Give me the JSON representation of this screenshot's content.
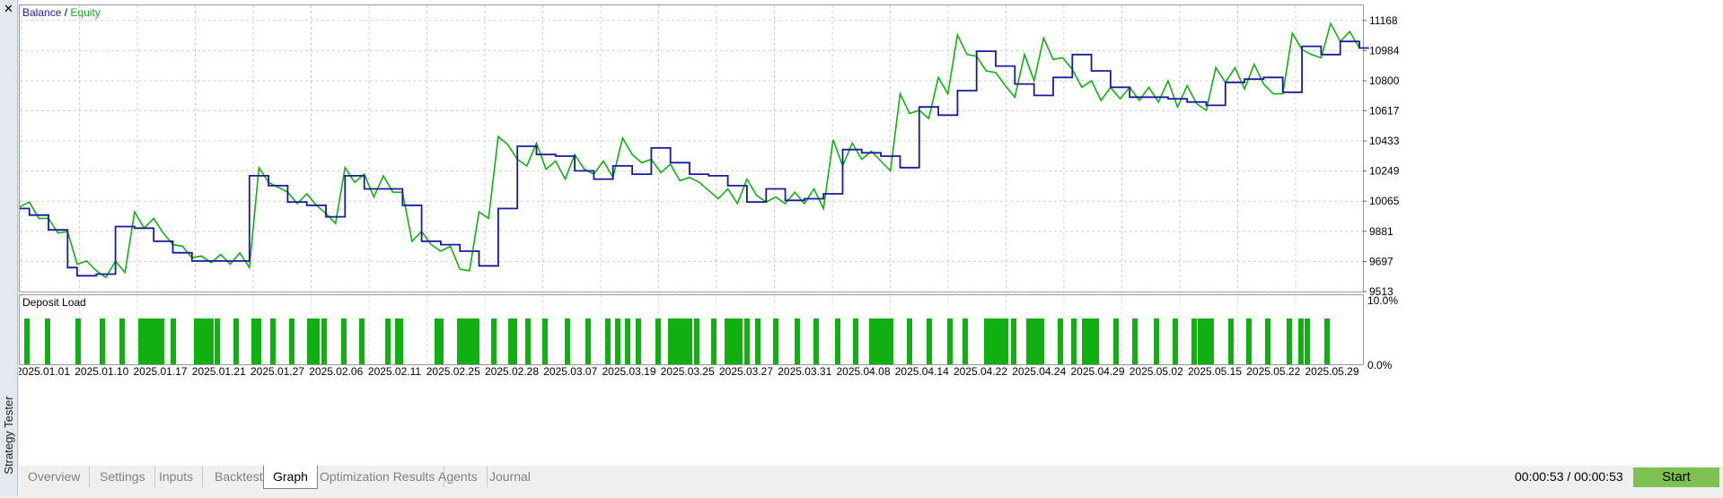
{
  "sidebar": {
    "close_icon": "close-icon",
    "title": "Strategy Tester"
  },
  "colors": {
    "balance": "#1a1a9c",
    "equity": "#11b011",
    "load": "#11b011",
    "grid": "#c8c8c8"
  },
  "tabs": [
    {
      "label": "Overview",
      "active": false
    },
    {
      "label": "Settings",
      "active": false
    },
    {
      "label": "Inputs",
      "active": false
    },
    {
      "label": "Backtest",
      "active": false
    },
    {
      "label": "Graph",
      "active": true
    },
    {
      "label": "Optimization Results",
      "active": false
    },
    {
      "label": "Agents",
      "active": false
    },
    {
      "label": "Journal",
      "active": false
    }
  ],
  "status": {
    "timer": "00:00:53 / 00:00:53",
    "start_label": "Start"
  },
  "chart_data": [
    {
      "type": "line",
      "legend": {
        "balance": "Balance",
        "separator": " / ",
        "equity": "Equity"
      },
      "ylim": [
        9513,
        11260
      ],
      "yticks": [
        11168,
        10984,
        10800,
        10617,
        10433,
        10249,
        10065,
        9881,
        9697,
        9513
      ],
      "grid": true,
      "series": [
        {
          "name": "Balance",
          "style": "step",
          "values": [
            10020,
            9980,
            9980,
            9890,
            9890,
            9660,
            9610,
            9610,
            9620,
            9620,
            9910,
            9910,
            9900,
            9900,
            9820,
            9820,
            9750,
            9750,
            9700,
            9700,
            9700,
            9700,
            9700,
            9700,
            10220,
            10220,
            10160,
            10160,
            10060,
            10060,
            10040,
            10040,
            9970,
            9970,
            10220,
            10220,
            10140,
            10140,
            10140,
            10140,
            10040,
            10040,
            9820,
            9820,
            9800,
            9800,
            9760,
            9760,
            9670,
            9670,
            10020,
            10020,
            10400,
            10400,
            10350,
            10350,
            10340,
            10340,
            10250,
            10250,
            10200,
            10200,
            10280,
            10280,
            10230,
            10230,
            10390,
            10390,
            10300,
            10300,
            10230,
            10230,
            10220,
            10220,
            10160,
            10160,
            10060,
            10060,
            10140,
            10140,
            10070,
            10070,
            10080,
            10080,
            10110,
            10110,
            10380,
            10380,
            10360,
            10360,
            10340,
            10340,
            10270,
            10270,
            10640,
            10640,
            10590,
            10590,
            10740,
            10740,
            10980,
            10980,
            10890,
            10890,
            10780,
            10780,
            10710,
            10710,
            10820,
            10820,
            10960,
            10960,
            10860,
            10860,
            10760,
            10760,
            10700,
            10700,
            10700,
            10700,
            10690,
            10690,
            10670,
            10670,
            10650,
            10650,
            10790,
            10790,
            10810,
            10810,
            10820,
            10820,
            10730,
            10730,
            11010,
            11010,
            10960,
            10960,
            11040,
            11040,
            11000,
            11000
          ]
        },
        {
          "name": "Equity",
          "style": "line",
          "values": [
            10030,
            10060,
            9960,
            9960,
            9870,
            9880,
            9680,
            9700,
            9640,
            9600,
            9700,
            9630,
            10000,
            9900,
            9960,
            9870,
            9800,
            9790,
            9720,
            9730,
            9690,
            9740,
            9680,
            9750,
            9660,
            10270,
            10180,
            10150,
            10120,
            10050,
            10110,
            10040,
            9990,
            9930,
            10270,
            10180,
            10230,
            10090,
            10220,
            10120,
            10120,
            9820,
            9880,
            9800,
            9760,
            9790,
            9650,
            9640,
            10000,
            9960,
            10460,
            10410,
            10320,
            10280,
            10420,
            10260,
            10310,
            10200,
            10350,
            10260,
            10230,
            10310,
            10210,
            10450,
            10350,
            10300,
            10320,
            10240,
            10290,
            10190,
            10210,
            10180,
            10130,
            10080,
            10140,
            10050,
            10200,
            10100,
            10060,
            10090,
            10050,
            10120,
            10050,
            10140,
            10020,
            10440,
            10280,
            10420,
            10320,
            10370,
            10310,
            10250,
            10720,
            10600,
            10620,
            10570,
            10820,
            10720,
            11080,
            10960,
            10950,
            10860,
            10850,
            10770,
            10700,
            10960,
            10800,
            11060,
            10930,
            10940,
            10870,
            10760,
            10800,
            10680,
            10760,
            10690,
            10760,
            10680,
            10760,
            10670,
            10800,
            10640,
            10770,
            10660,
            10620,
            10880,
            10790,
            10880,
            10750,
            10900,
            10780,
            10720,
            10720,
            11090,
            10990,
            10960,
            10940,
            11150,
            11040,
            11100,
            11000
          ]
        }
      ]
    },
    {
      "type": "bar",
      "title": "Deposit Load",
      "ylim": [
        0,
        10
      ],
      "ylabels": [
        "10.0%",
        "0.0%"
      ],
      "values": [
        7,
        7,
        7,
        7,
        7,
        7,
        7,
        7,
        7,
        7,
        7,
        7,
        7,
        7,
        7,
        7,
        7,
        7,
        7,
        7,
        7,
        7,
        7,
        7,
        7,
        7,
        7,
        7,
        7,
        7,
        7,
        7,
        7,
        7,
        7,
        7,
        7,
        7,
        7,
        7,
        7,
        7,
        7,
        7,
        7,
        7,
        7,
        7,
        7,
        7,
        7,
        7,
        7,
        7,
        7,
        7,
        7,
        7,
        7,
        7,
        7,
        7,
        7,
        7,
        7,
        7,
        7,
        7,
        7,
        7,
        7,
        7,
        7,
        7,
        7,
        7,
        7,
        7,
        7,
        7,
        7,
        7,
        7,
        7,
        7,
        7,
        7,
        7,
        7,
        7,
        7,
        7,
        7,
        7,
        7,
        7,
        7,
        7,
        7,
        7,
        7,
        7,
        7,
        7,
        7,
        7,
        7,
        7,
        7,
        7,
        7,
        7,
        7,
        7,
        7
      ],
      "categories": [
        "2025.01.01",
        "2025.01.10",
        "2025.01.17",
        "2025.01.21",
        "2025.01.27",
        "2025.02.06",
        "2025.02.11",
        "2025.02.25",
        "2025.02.28",
        "2025.03.07",
        "2025.03.19",
        "2025.03.25",
        "2025.03.27",
        "2025.03.31",
        "2025.04.08",
        "2025.04.14",
        "2025.04.22",
        "2025.04.24",
        "2025.04.29",
        "2025.05.02",
        "2025.05.15",
        "2025.05.22",
        "2025.05.29"
      ]
    }
  ]
}
